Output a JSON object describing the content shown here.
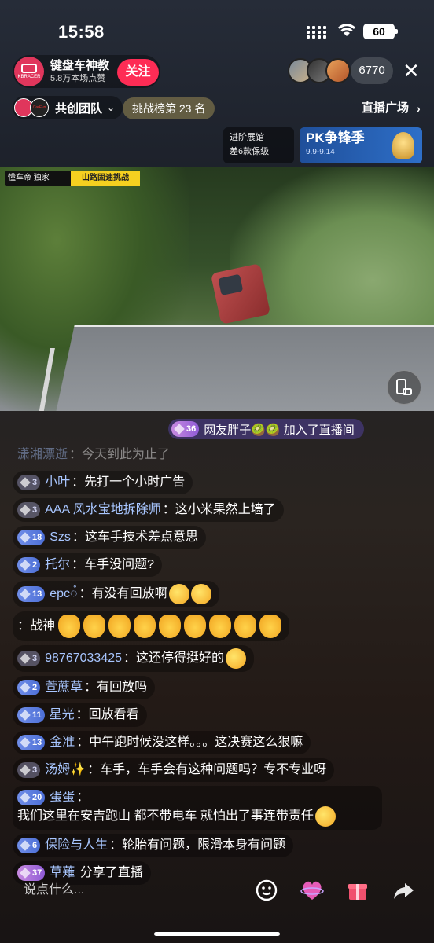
{
  "status_bar": {
    "time": "15:58",
    "battery": "60"
  },
  "host": {
    "name": "键盘车神教",
    "likes": "5.8万本场点赞",
    "avatar_text": "KBRACER",
    "follow_label": "关注"
  },
  "viewers": {
    "count": "6770"
  },
  "team": {
    "name": "共创团队",
    "logo_text": "CarFun"
  },
  "rank": "挑战榜第 23 名",
  "live_square": "直播广场",
  "upgrade_card": {
    "line1": "进阶展馆",
    "line2": "差6款保级"
  },
  "pk_card": {
    "title": "PK争锋季",
    "date": "9.9-9.14"
  },
  "video": {
    "logo_left": "懂车帝 独家",
    "logo_right": "山路固速挑战"
  },
  "join_banner": {
    "level": "36",
    "text": "网友胖子🥝🥝  加入了直播间"
  },
  "chat": [
    {
      "level": "",
      "user": "潇湘漂逝",
      "text": "今天到此为止了",
      "faded": true
    },
    {
      "level": "3",
      "user": "小叶",
      "text": "先打一个小时广告"
    },
    {
      "level": "3",
      "user": "AAA 风水宝地拆除师",
      "text": "这小米果然上墙了"
    },
    {
      "level": "18",
      "user": "Szs",
      "text": "这车手技术差点意思"
    },
    {
      "level": "2",
      "user": "托尔",
      "text": "车手没问题?"
    },
    {
      "level": "13",
      "user": "epc◌̊",
      "text": "有没有回放啊"
    },
    {
      "level": "",
      "user": "",
      "text": "战神"
    },
    {
      "level": "3",
      "user": "98767033425",
      "text": "这还停得挺好的"
    },
    {
      "level": "2",
      "user": "萱蔗草",
      "text": "有回放吗"
    },
    {
      "level": "11",
      "user": "星光",
      "text": "回放看看"
    },
    {
      "level": "13",
      "user": "金准",
      "text": "中午跑时候没这样。。。这决赛这么狠嘛"
    },
    {
      "level": "3",
      "user": "汤姆✨",
      "text": "车手，车手会有这种问题吗？专不专业呀"
    },
    {
      "level": "20",
      "user": "蛋蛋",
      "text": "我们这里在安吉跑山  都不带电车   就怕出了事连带责任"
    },
    {
      "level": "6",
      "user": "保险与人生",
      "text": "轮胎有问题，限滑本身有问题"
    },
    {
      "level": "37",
      "user": "草薙",
      "text": "分享了直播"
    }
  ],
  "input": {
    "placeholder": "说点什么..."
  },
  "colors": {
    "accent": "#fe2c55",
    "username": "#a8c6ff"
  }
}
